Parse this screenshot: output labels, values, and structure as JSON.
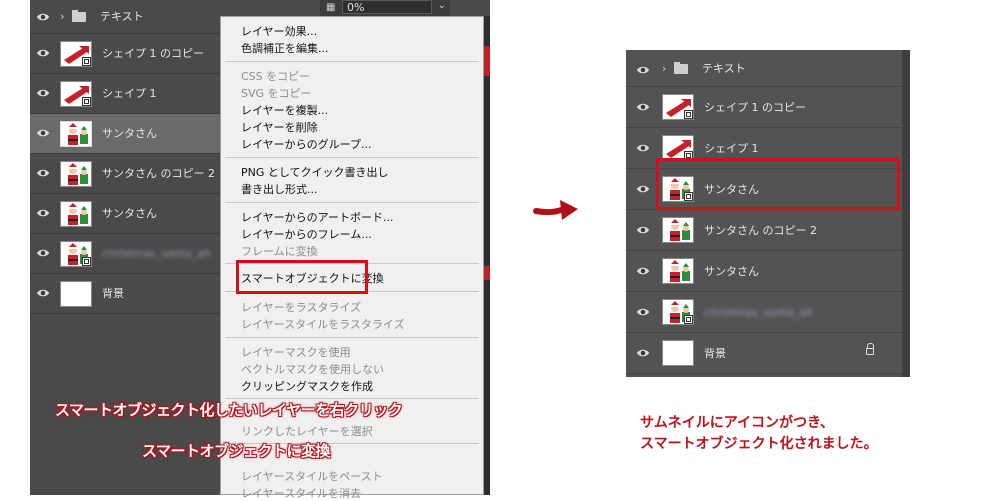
{
  "left_panel": {
    "opacity_value": "0%",
    "layers": [
      {
        "name": "テキスト"
      },
      {
        "name": "シェイプ 1 のコピー"
      },
      {
        "name": "シェイプ 1"
      },
      {
        "name": "サンタさん"
      },
      {
        "name": "サンタさん のコピー 2"
      },
      {
        "name": "サンタさん"
      },
      {
        "name": "christmas_santa_all"
      },
      {
        "name": "背景"
      }
    ]
  },
  "context_menu": {
    "items": [
      "レイヤー効果...",
      "色調補正を編集...",
      "CSS をコピー",
      "SVG をコピー",
      "レイヤーを複製...",
      "レイヤーを削除",
      "レイヤーからのグループ...",
      "PNG としてクイック書き出し",
      "書き出し形式...",
      "レイヤーからのアートボード...",
      "レイヤーからのフレーム...",
      "フレームに変換",
      "スマートオブジェクトに変換",
      "レイヤーをラスタライズ",
      "レイヤースタイルをラスタライズ",
      "レイヤーマスクを使用",
      "ベクトルマスクを使用しない",
      "クリッピングマスクを作成",
      "リンクしたレイヤーを選択",
      "レイヤースタイルをペースト",
      "レイヤースタイルを消去"
    ]
  },
  "annotations": {
    "left_line1": "スマートオブジェクト化したいレイヤーを右クリック",
    "left_line2": "スマートオブジェクトに変換",
    "right_line1": "サムネイルにアイコンがつき、",
    "right_line2": "スマートオブジェクト化されました。"
  },
  "right_panel": {
    "layers": [
      {
        "name": "テキスト"
      },
      {
        "name": "シェイプ 1 のコピー"
      },
      {
        "name": "シェイプ 1"
      },
      {
        "name": "サンタさん"
      },
      {
        "name": "サンタさん のコピー 2"
      },
      {
        "name": "サンタさん"
      },
      {
        "name": "christmas_santa_all"
      },
      {
        "name": "背景"
      }
    ]
  },
  "colors": {
    "panel_bg": "#4a4a4a",
    "menu_bg": "#f0f0f0",
    "highlight_red": "#d0101a",
    "caption_red": "#c0101a"
  },
  "icons": [
    "eye-icon",
    "folder-icon",
    "chevron-right-icon",
    "lock-icon",
    "smart-object-badge-icon",
    "arrow-right-icon"
  ]
}
